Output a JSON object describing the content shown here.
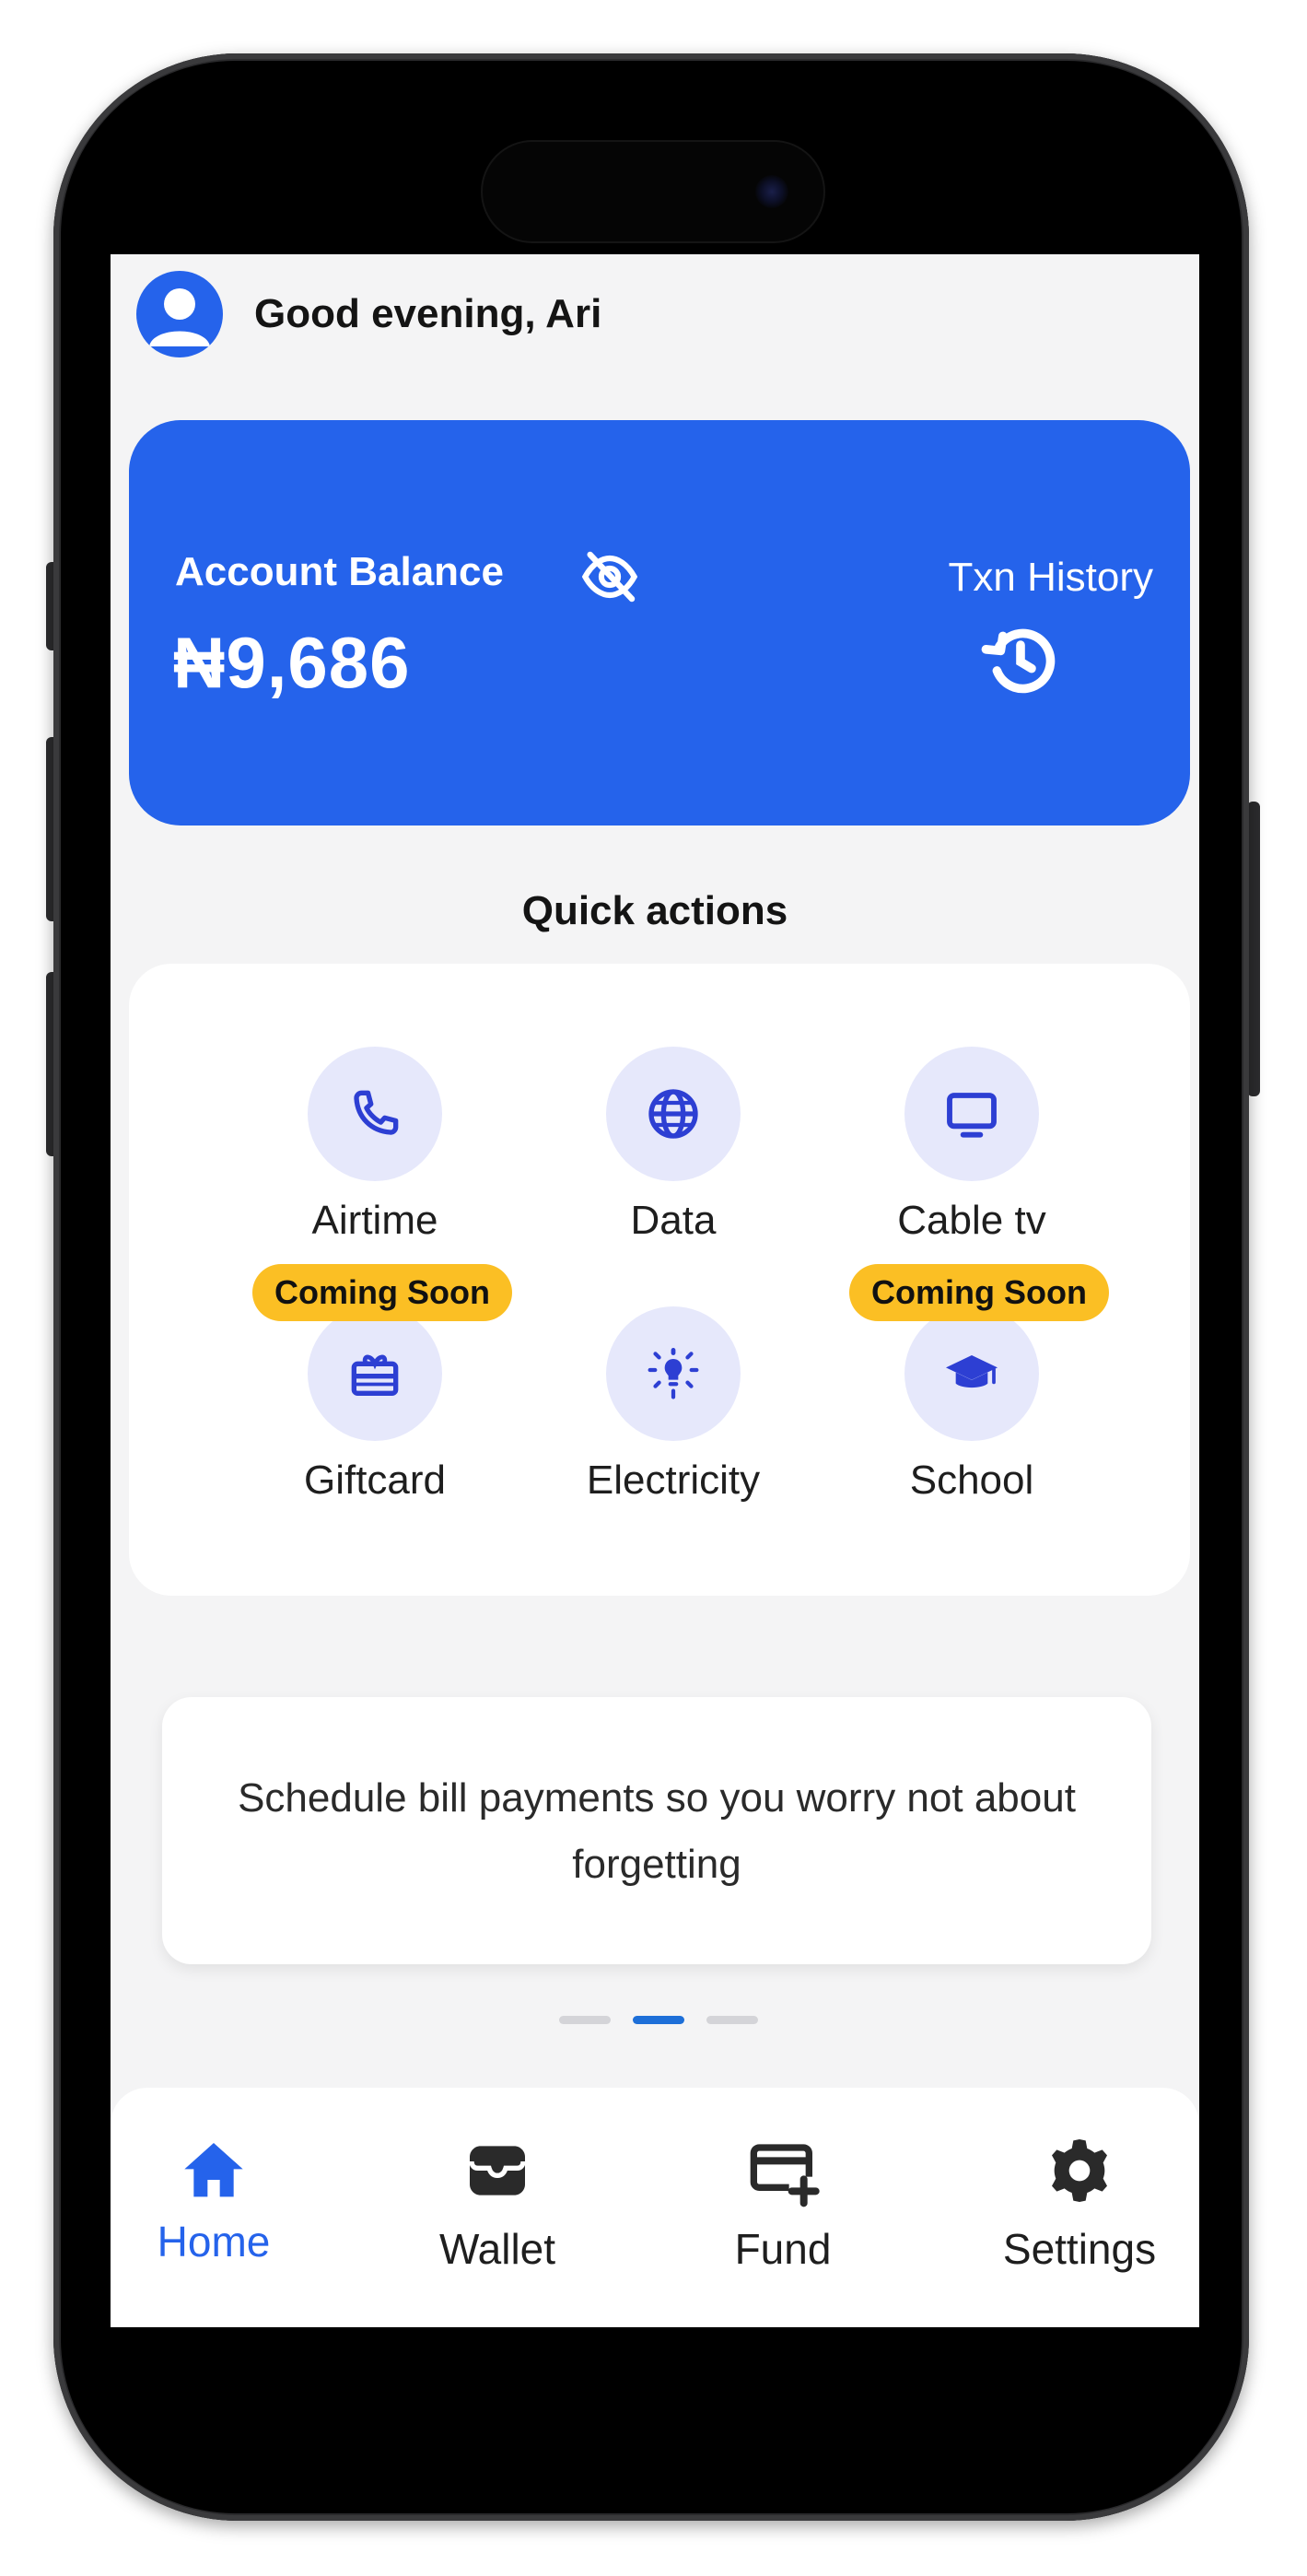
{
  "header": {
    "greeting": "Good evening, Ari"
  },
  "balance": {
    "label": "Account Balance",
    "amount": "₦9,686",
    "txn_label": "Txn History"
  },
  "quick_actions": {
    "title": "Quick actions",
    "items": [
      {
        "label": "Airtime",
        "icon": "phone-icon",
        "badge": ""
      },
      {
        "label": "Data",
        "icon": "globe-icon",
        "badge": ""
      },
      {
        "label": "Cable tv",
        "icon": "tv-icon",
        "badge": ""
      },
      {
        "label": "Giftcard",
        "icon": "gift-icon",
        "badge": "Coming Soon"
      },
      {
        "label": "Electricity",
        "icon": "lightbulb-icon",
        "badge": ""
      },
      {
        "label": "School",
        "icon": "graduation-cap-icon",
        "badge": "Coming Soon"
      }
    ]
  },
  "banner": {
    "text": "Schedule bill payments so you worry not about forgetting"
  },
  "carousel": {
    "count": 3,
    "active": 2
  },
  "nav": {
    "items": [
      {
        "label": "Home",
        "icon": "home-icon",
        "active": true
      },
      {
        "label": "Wallet",
        "icon": "wallet-icon",
        "active": false
      },
      {
        "label": "Fund",
        "icon": "card-plus-icon",
        "active": false
      },
      {
        "label": "Settings",
        "icon": "gear-icon",
        "active": false
      }
    ]
  },
  "colors": {
    "primary": "#2563eb",
    "badge": "#fbbf24",
    "screen_background": "#f4f4f5",
    "icon_circle": "#e6e8fb",
    "nav_active": "#2563eb"
  }
}
